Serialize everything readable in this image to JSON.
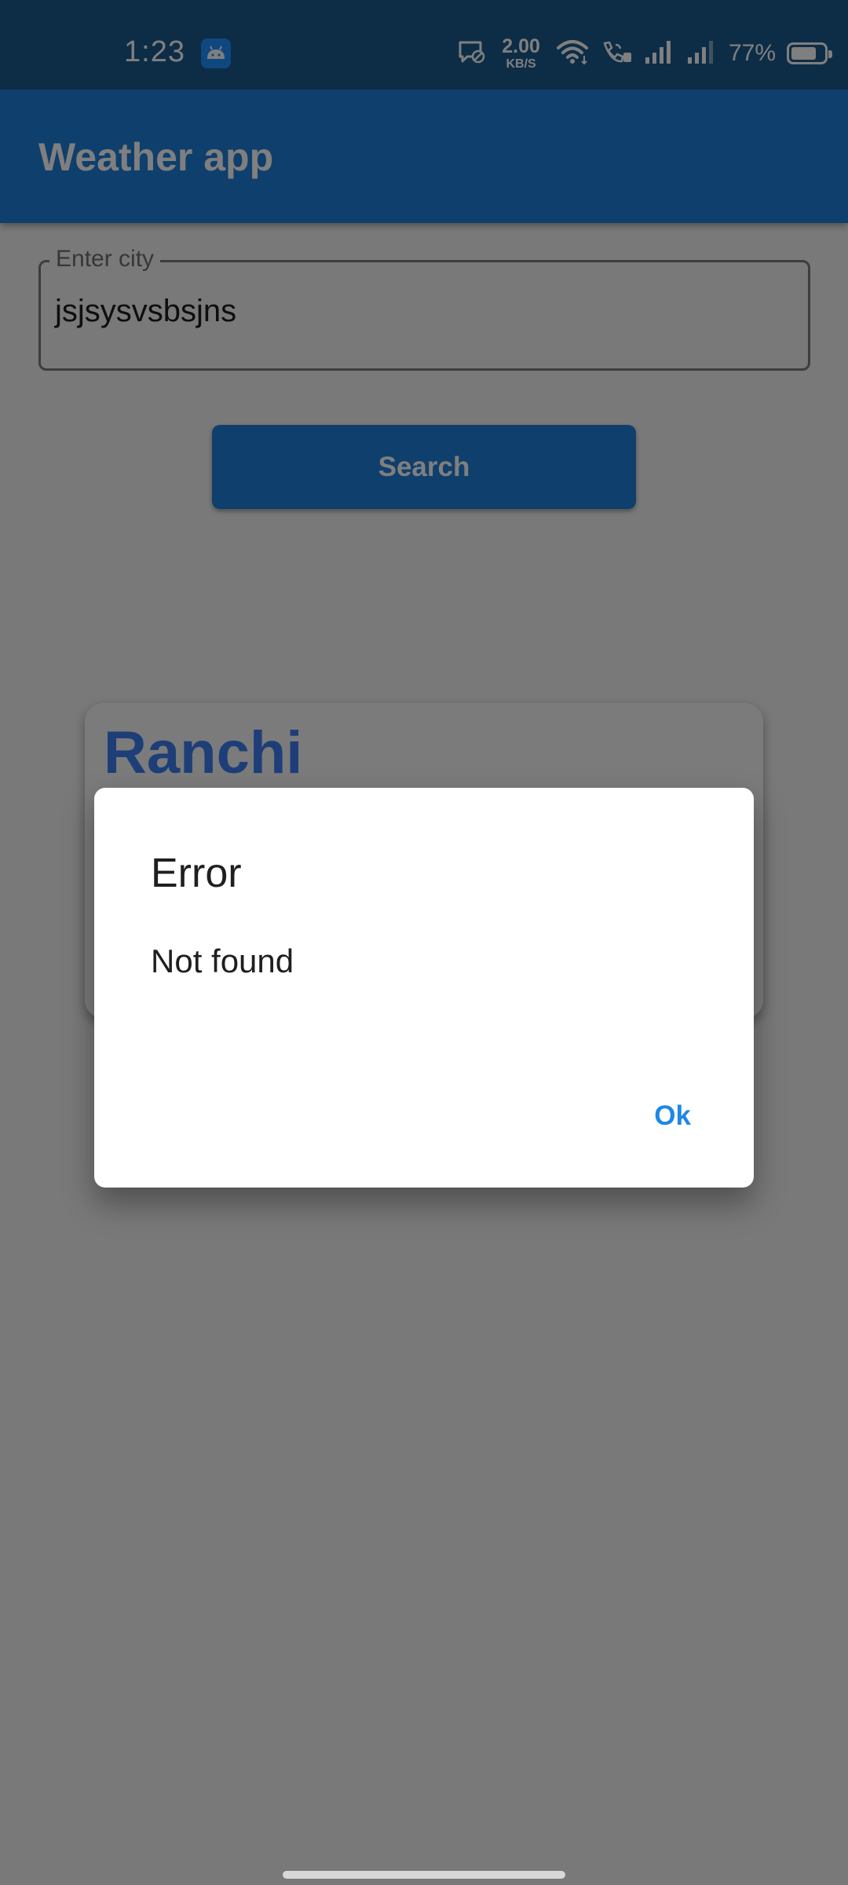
{
  "status_bar": {
    "time": "1:23",
    "net_speed_value": "2.00",
    "net_speed_unit": "KB/S",
    "battery_percent": "77%",
    "battery_level": 0.77
  },
  "app_bar": {
    "title": "Weather app"
  },
  "search_form": {
    "city_label": "Enter city",
    "city_value": "jsjsysvsbsjns",
    "search_button_label": "Search"
  },
  "weather_card": {
    "city": "Ranchi"
  },
  "dialog": {
    "title": "Error",
    "message": "Not found",
    "ok_label": "Ok"
  },
  "colors": {
    "app_bar": "#1e7ed9",
    "accent": "#1e88e5",
    "card_city": "#3c7cf0"
  }
}
